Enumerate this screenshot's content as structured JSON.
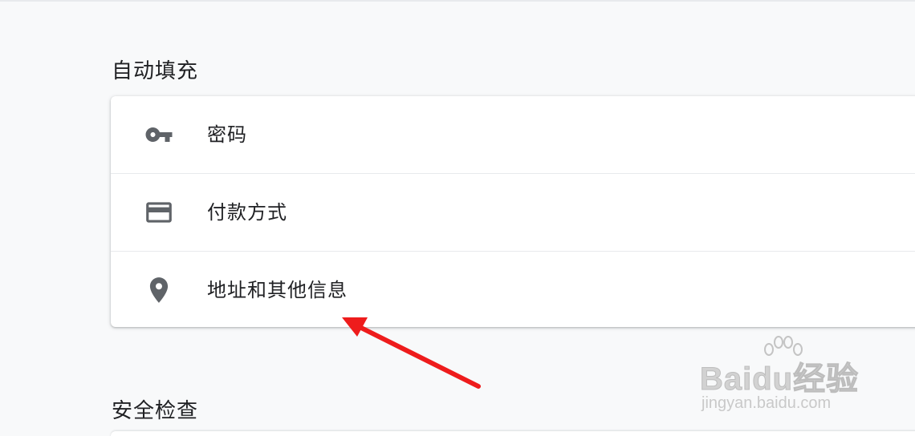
{
  "sections": {
    "autofill_title": "自动填充",
    "safety_title": "安全检查"
  },
  "autofill_items": [
    {
      "label": "密码",
      "icon": "key-icon"
    },
    {
      "label": "付款方式",
      "icon": "credit-card-icon"
    },
    {
      "label": "地址和其他信息",
      "icon": "location-pin-icon"
    }
  ],
  "colors": {
    "background": "#f8f9fa",
    "card": "#ffffff",
    "icon": "#5f6368",
    "text": "#202124",
    "annotation_arrow": "#ee1c1c"
  },
  "watermark": {
    "logo_text": "Baidu经验",
    "url": "jingyan.baidu.com"
  }
}
